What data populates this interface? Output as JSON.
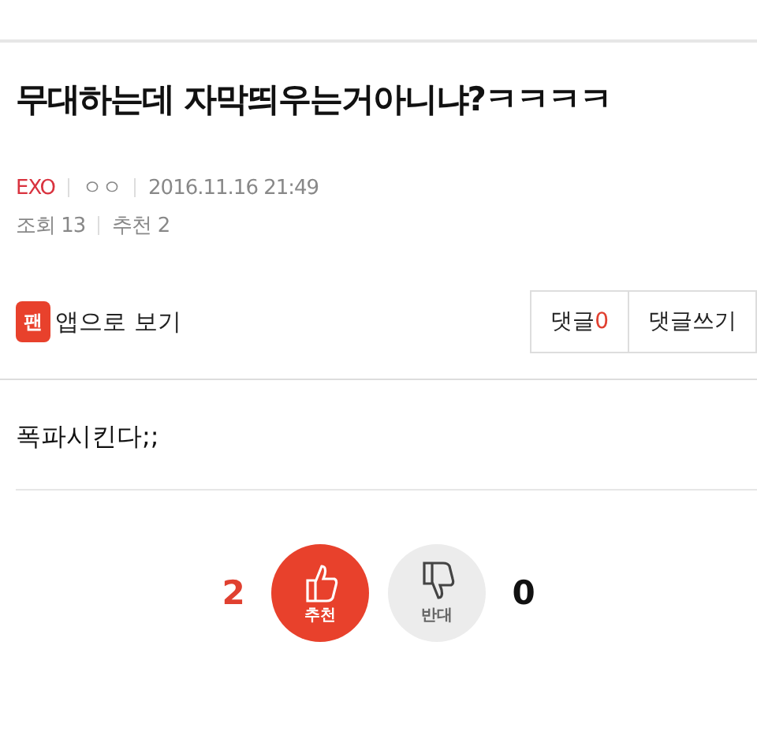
{
  "article": {
    "title": "무대하는데 자막띄우는거아니냐?ㅋㅋㅋㅋ",
    "category": "EXO",
    "author": "ㅇㅇ",
    "datetime": "2016.11.16 21:49",
    "views_label": "조회",
    "views": "13",
    "recommend_label": "추천",
    "recommend": "2"
  },
  "toolbar": {
    "app_icon": "팬",
    "app_link": "앱으로 보기",
    "comments_label": "댓글",
    "comments_count": "0",
    "write_comment": "댓글쓰기"
  },
  "body": "폭파시킨다;;",
  "votes": {
    "up_count": "2",
    "up_label": "추천",
    "down_label": "반대",
    "down_count": "0"
  }
}
